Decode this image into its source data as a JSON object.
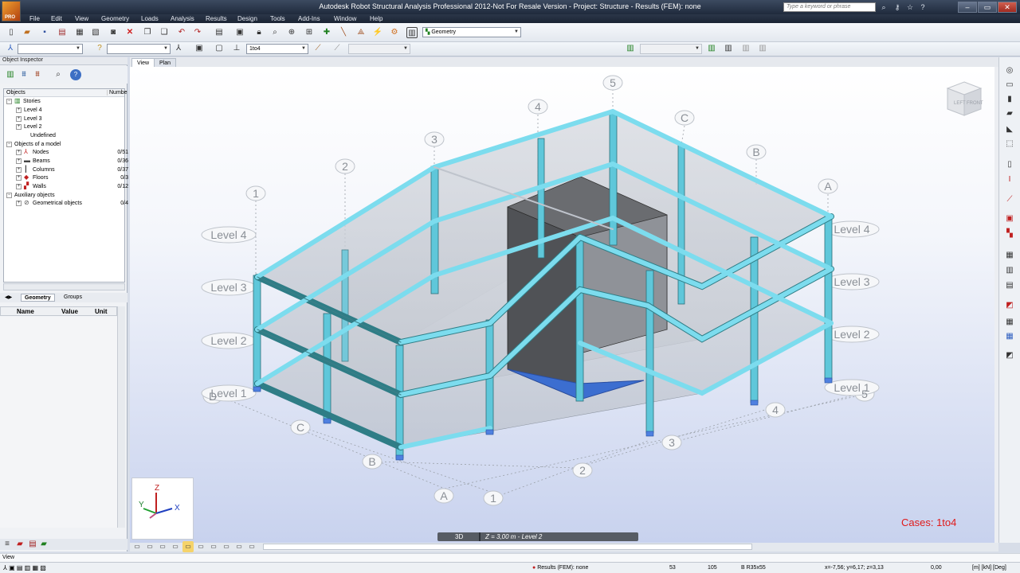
{
  "app": {
    "title": "Autodesk Robot Structural Analysis Professional 2012-Not For Resale Version - Project: Structure - Results (FEM): none",
    "logo_label": "PRO",
    "search_placeholder": "Type a keyword or phrase"
  },
  "menu": [
    "File",
    "Edit",
    "View",
    "Geometry",
    "Loads",
    "Analysis",
    "Results",
    "Design",
    "Tools",
    "Add-Ins",
    "Window",
    "Help"
  ],
  "toolbar": {
    "layout_combo": "Geometry",
    "case_combo": "1to4"
  },
  "object_inspector": {
    "title": "Object Inspector",
    "columns": {
      "objects": "Objects",
      "number": "Numbe"
    },
    "tree": [
      {
        "label": "Stories",
        "level": 0,
        "count": ""
      },
      {
        "label": "Level 4",
        "level": 1,
        "count": ""
      },
      {
        "label": "Level 3",
        "level": 1,
        "count": ""
      },
      {
        "label": "Level 2",
        "level": 1,
        "count": ""
      },
      {
        "label": "Undefined",
        "level": 1,
        "count": ""
      },
      {
        "label": "Objects of a model",
        "level": 0,
        "count": ""
      },
      {
        "label": "Nodes",
        "level": 1,
        "count": "0/51"
      },
      {
        "label": "Beams",
        "level": 1,
        "count": "0/36"
      },
      {
        "label": "Columns",
        "level": 1,
        "count": "0/37"
      },
      {
        "label": "Floors",
        "level": 1,
        "count": "0/3"
      },
      {
        "label": "Walls",
        "level": 1,
        "count": "0/12"
      },
      {
        "label": "Auxiliary objects",
        "level": 0,
        "count": ""
      },
      {
        "label": "Geometrical objects",
        "level": 1,
        "count": "0/4"
      }
    ],
    "tabs": [
      "Geometry",
      "Groups"
    ],
    "props_columns": [
      "Name",
      "Value",
      "Unit"
    ]
  },
  "view_tabs": [
    "View",
    "Plan"
  ],
  "viewport": {
    "level_labels": [
      "Level 4",
      "Level 3",
      "Level 2",
      "Level 1"
    ],
    "grid_numbers": [
      "1",
      "2",
      "3",
      "4",
      "5"
    ],
    "grid_letters": [
      "A",
      "B",
      "C"
    ],
    "cases_label": "Cases: 1to4",
    "view_mode": "3D",
    "level_indicator": "Z = 3,00 m - Level 2",
    "axis": {
      "z": "Z",
      "y": "Y",
      "x": "X"
    },
    "cube_faces": {
      "left": "LEFT",
      "front": "FRONT"
    },
    "colors": {
      "beam": "#7cdcee",
      "beam_dark": "#2f7d86",
      "wall": "#5e5e5e",
      "slab": "#c8ccd4"
    }
  },
  "view_label": "View",
  "status": {
    "results": "Results (FEM): none",
    "n1": "53",
    "n2": "105",
    "section": "B R35x55",
    "coords": "x=-7,56; y=6,17; z=3,13",
    "zero": "0,00",
    "units": "[m] [kN] [Deg]"
  }
}
